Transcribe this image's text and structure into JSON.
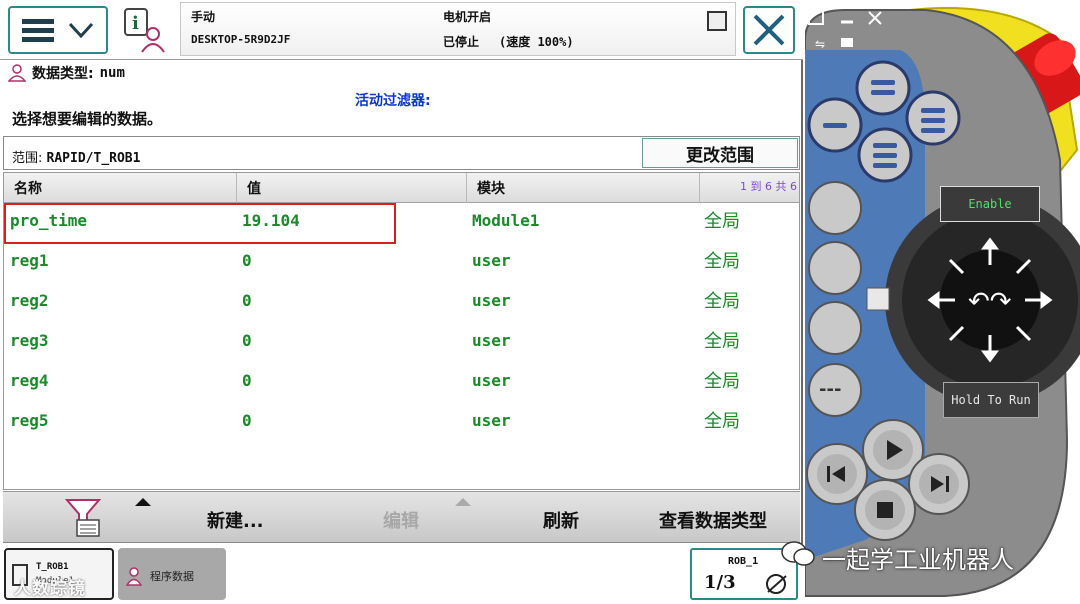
{
  "header": {
    "mode": "手动",
    "host": "DESKTOP-5R9D2JF",
    "motor": "电机开启",
    "state": "已停止",
    "speed": "(速度 100%)"
  },
  "datatype": {
    "label": "数据类型:",
    "value": "num"
  },
  "select_prompt": "选择想要编辑的数据。",
  "active_filter_label": "活动过滤器:",
  "scope": {
    "label": "范围:",
    "value": "RAPID/T_ROB1",
    "button": "更改范围"
  },
  "table": {
    "columns": [
      "名称",
      "值",
      "模块"
    ],
    "range_text": "1 到 6 共 6",
    "rows": [
      {
        "name": "pro_time",
        "value": "19.104",
        "module": "Module1",
        "scope": "全局"
      },
      {
        "name": "reg1",
        "value": "0",
        "module": "user",
        "scope": "全局"
      },
      {
        "name": "reg2",
        "value": "0",
        "module": "user",
        "scope": "全局"
      },
      {
        "name": "reg3",
        "value": "0",
        "module": "user",
        "scope": "全局"
      },
      {
        "name": "reg4",
        "value": "0",
        "module": "user",
        "scope": "全局"
      },
      {
        "name": "reg5",
        "value": "0",
        "module": "user",
        "scope": "全局"
      }
    ]
  },
  "commands": {
    "new": "新建...",
    "edit": "编辑",
    "refresh": "刷新",
    "view_type": "查看数据类型"
  },
  "taskbar": {
    "task1_line1": "T_ROB1",
    "task1_line2": "Module1",
    "task2_label": "程序数据",
    "quickset_label": "ROB_1",
    "quickset_fraction": "1/3"
  },
  "pendant": {
    "enable_label": "Enable",
    "hold_label": "Hold To Run"
  },
  "watermarks": {
    "left": "人数踪镜",
    "right": "一起学工业机器人"
  },
  "colors": {
    "accent_teal": "#2a8a8a",
    "data_green": "#1a8a2a",
    "filter_blue": "#0a38c8",
    "selection_red": "#d82020",
    "emergency_red": "#d81818",
    "pendant_yellow": "#f0e020"
  }
}
